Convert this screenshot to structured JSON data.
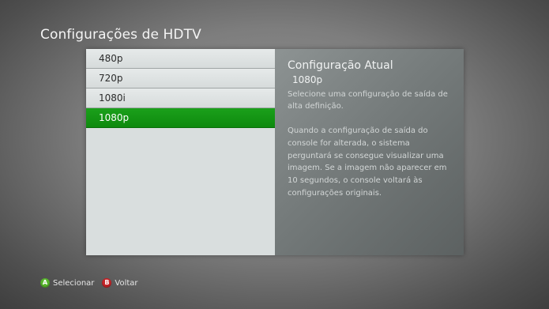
{
  "page_title": "Configurações de HDTV",
  "options": [
    {
      "label": "480p",
      "selected": false
    },
    {
      "label": "720p",
      "selected": false
    },
    {
      "label": "1080i",
      "selected": false
    },
    {
      "label": "1080p",
      "selected": true
    }
  ],
  "info": {
    "title": "Configuração Atual",
    "current_value": "1080p",
    "description": "Selecione uma configuração de saída de alta definição.",
    "detail": "Quando a configuração de saída do console for alterada, o sistema perguntará se consegue visualizar uma imagem. Se a imagem não aparecer em 10 segundos, o console voltará às configurações originais."
  },
  "footer": {
    "a_glyph": "A",
    "a_label": "Selecionar",
    "b_glyph": "B",
    "b_label": "Voltar"
  },
  "colors": {
    "selection": "#149614",
    "a_button": "#5ab82e",
    "b_button": "#c8262a"
  }
}
